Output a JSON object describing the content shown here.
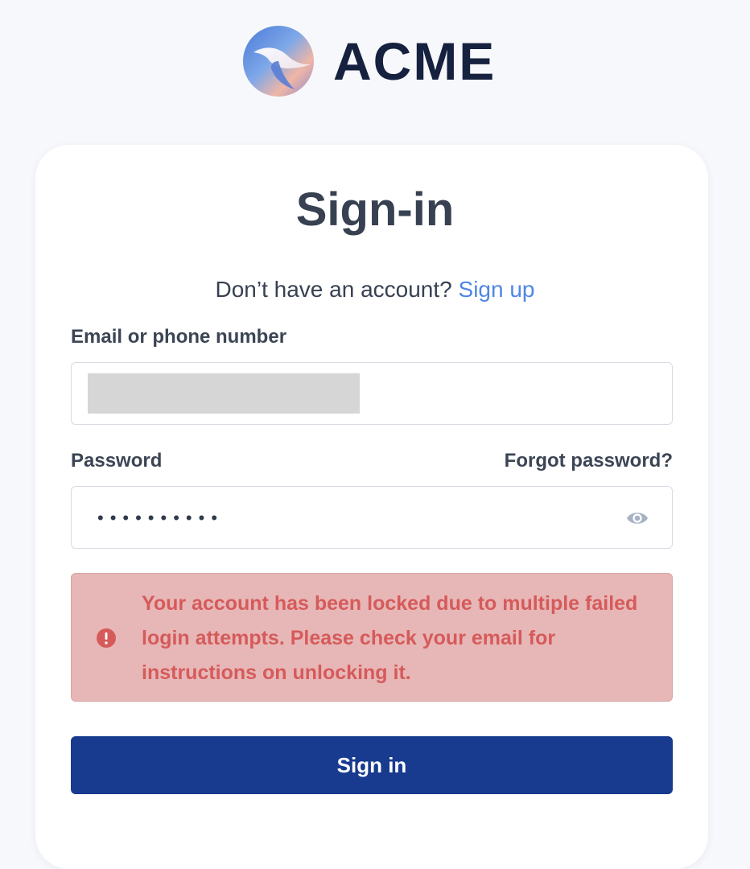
{
  "brand": {
    "name": "ACME",
    "logo_icon": "acme-logo-icon"
  },
  "page": {
    "title": "Sign-in",
    "signup_prompt": "Don’t have an account?",
    "signup_link": "Sign up"
  },
  "form": {
    "email_label": "Email or phone number",
    "email_value": "",
    "password_label": "Password",
    "forgot_password": "Forgot password?",
    "password_mask": "••••••••••",
    "password_visibility_icon": "eye-icon"
  },
  "alert": {
    "icon": "alert-circle-icon",
    "message": "Your account has been locked due to multiple failed login attempts. Please check your email for instructions on unlocking it."
  },
  "actions": {
    "sign_in_label": "Sign in"
  },
  "colors": {
    "accent_link": "#4f86e6",
    "primary_button": "#183a8f",
    "error_bg": "#e7b7b7",
    "error_text": "#d65a5a",
    "brand_text": "#15213f"
  }
}
